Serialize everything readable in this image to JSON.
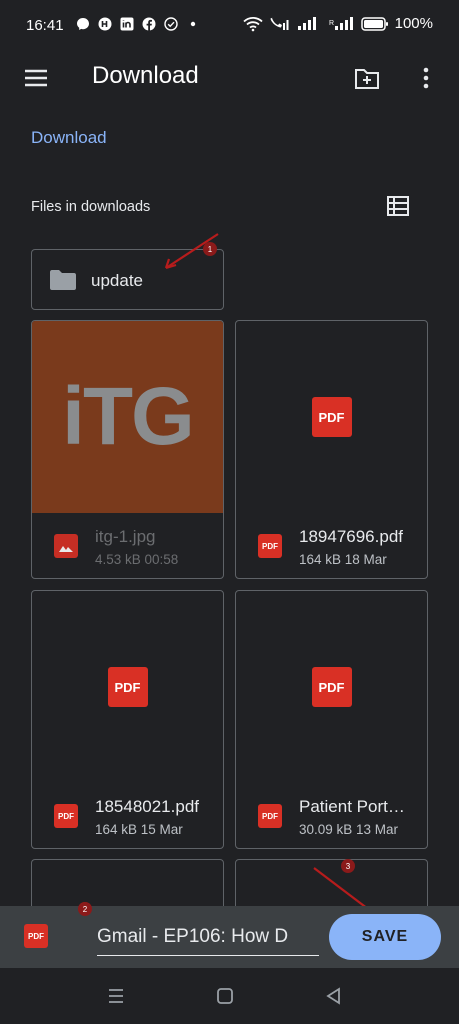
{
  "status_bar": {
    "time": "16:41",
    "battery": "100%",
    "icons": [
      "messenger-icon",
      "app-icon",
      "linkedin-icon",
      "facebook-icon",
      "check-icon",
      "dot-icon"
    ]
  },
  "app_bar": {
    "title": "Download"
  },
  "breadcrumb": "Download",
  "section": {
    "title": "Files in downloads"
  },
  "folders": [
    {
      "name": "update"
    }
  ],
  "files": [
    {
      "name": "itg-1.jpg",
      "meta": "4.53 kB 00:58",
      "type": "image",
      "thumb_text": "iTG"
    },
    {
      "name": "18947696.pdf",
      "meta": "164 kB 18 Mar",
      "type": "pdf",
      "badge": "PDF"
    },
    {
      "name": "18548021.pdf",
      "meta": "164 kB 15 Mar",
      "type": "pdf",
      "badge": "PDF"
    },
    {
      "name": "Patient Port…",
      "meta": "30.09 kB 13 Mar",
      "type": "pdf",
      "badge": "PDF"
    }
  ],
  "save_bar": {
    "file_icon_label": "PDF",
    "filename": "Gmail - EP106: How D",
    "save_label": "SAVE"
  },
  "annotations": [
    "1",
    "2",
    "3"
  ],
  "colors": {
    "background": "#202124",
    "accent": "#8ab4f8",
    "pdf_red": "#d93025",
    "annotation_red": "#b71c1c"
  }
}
